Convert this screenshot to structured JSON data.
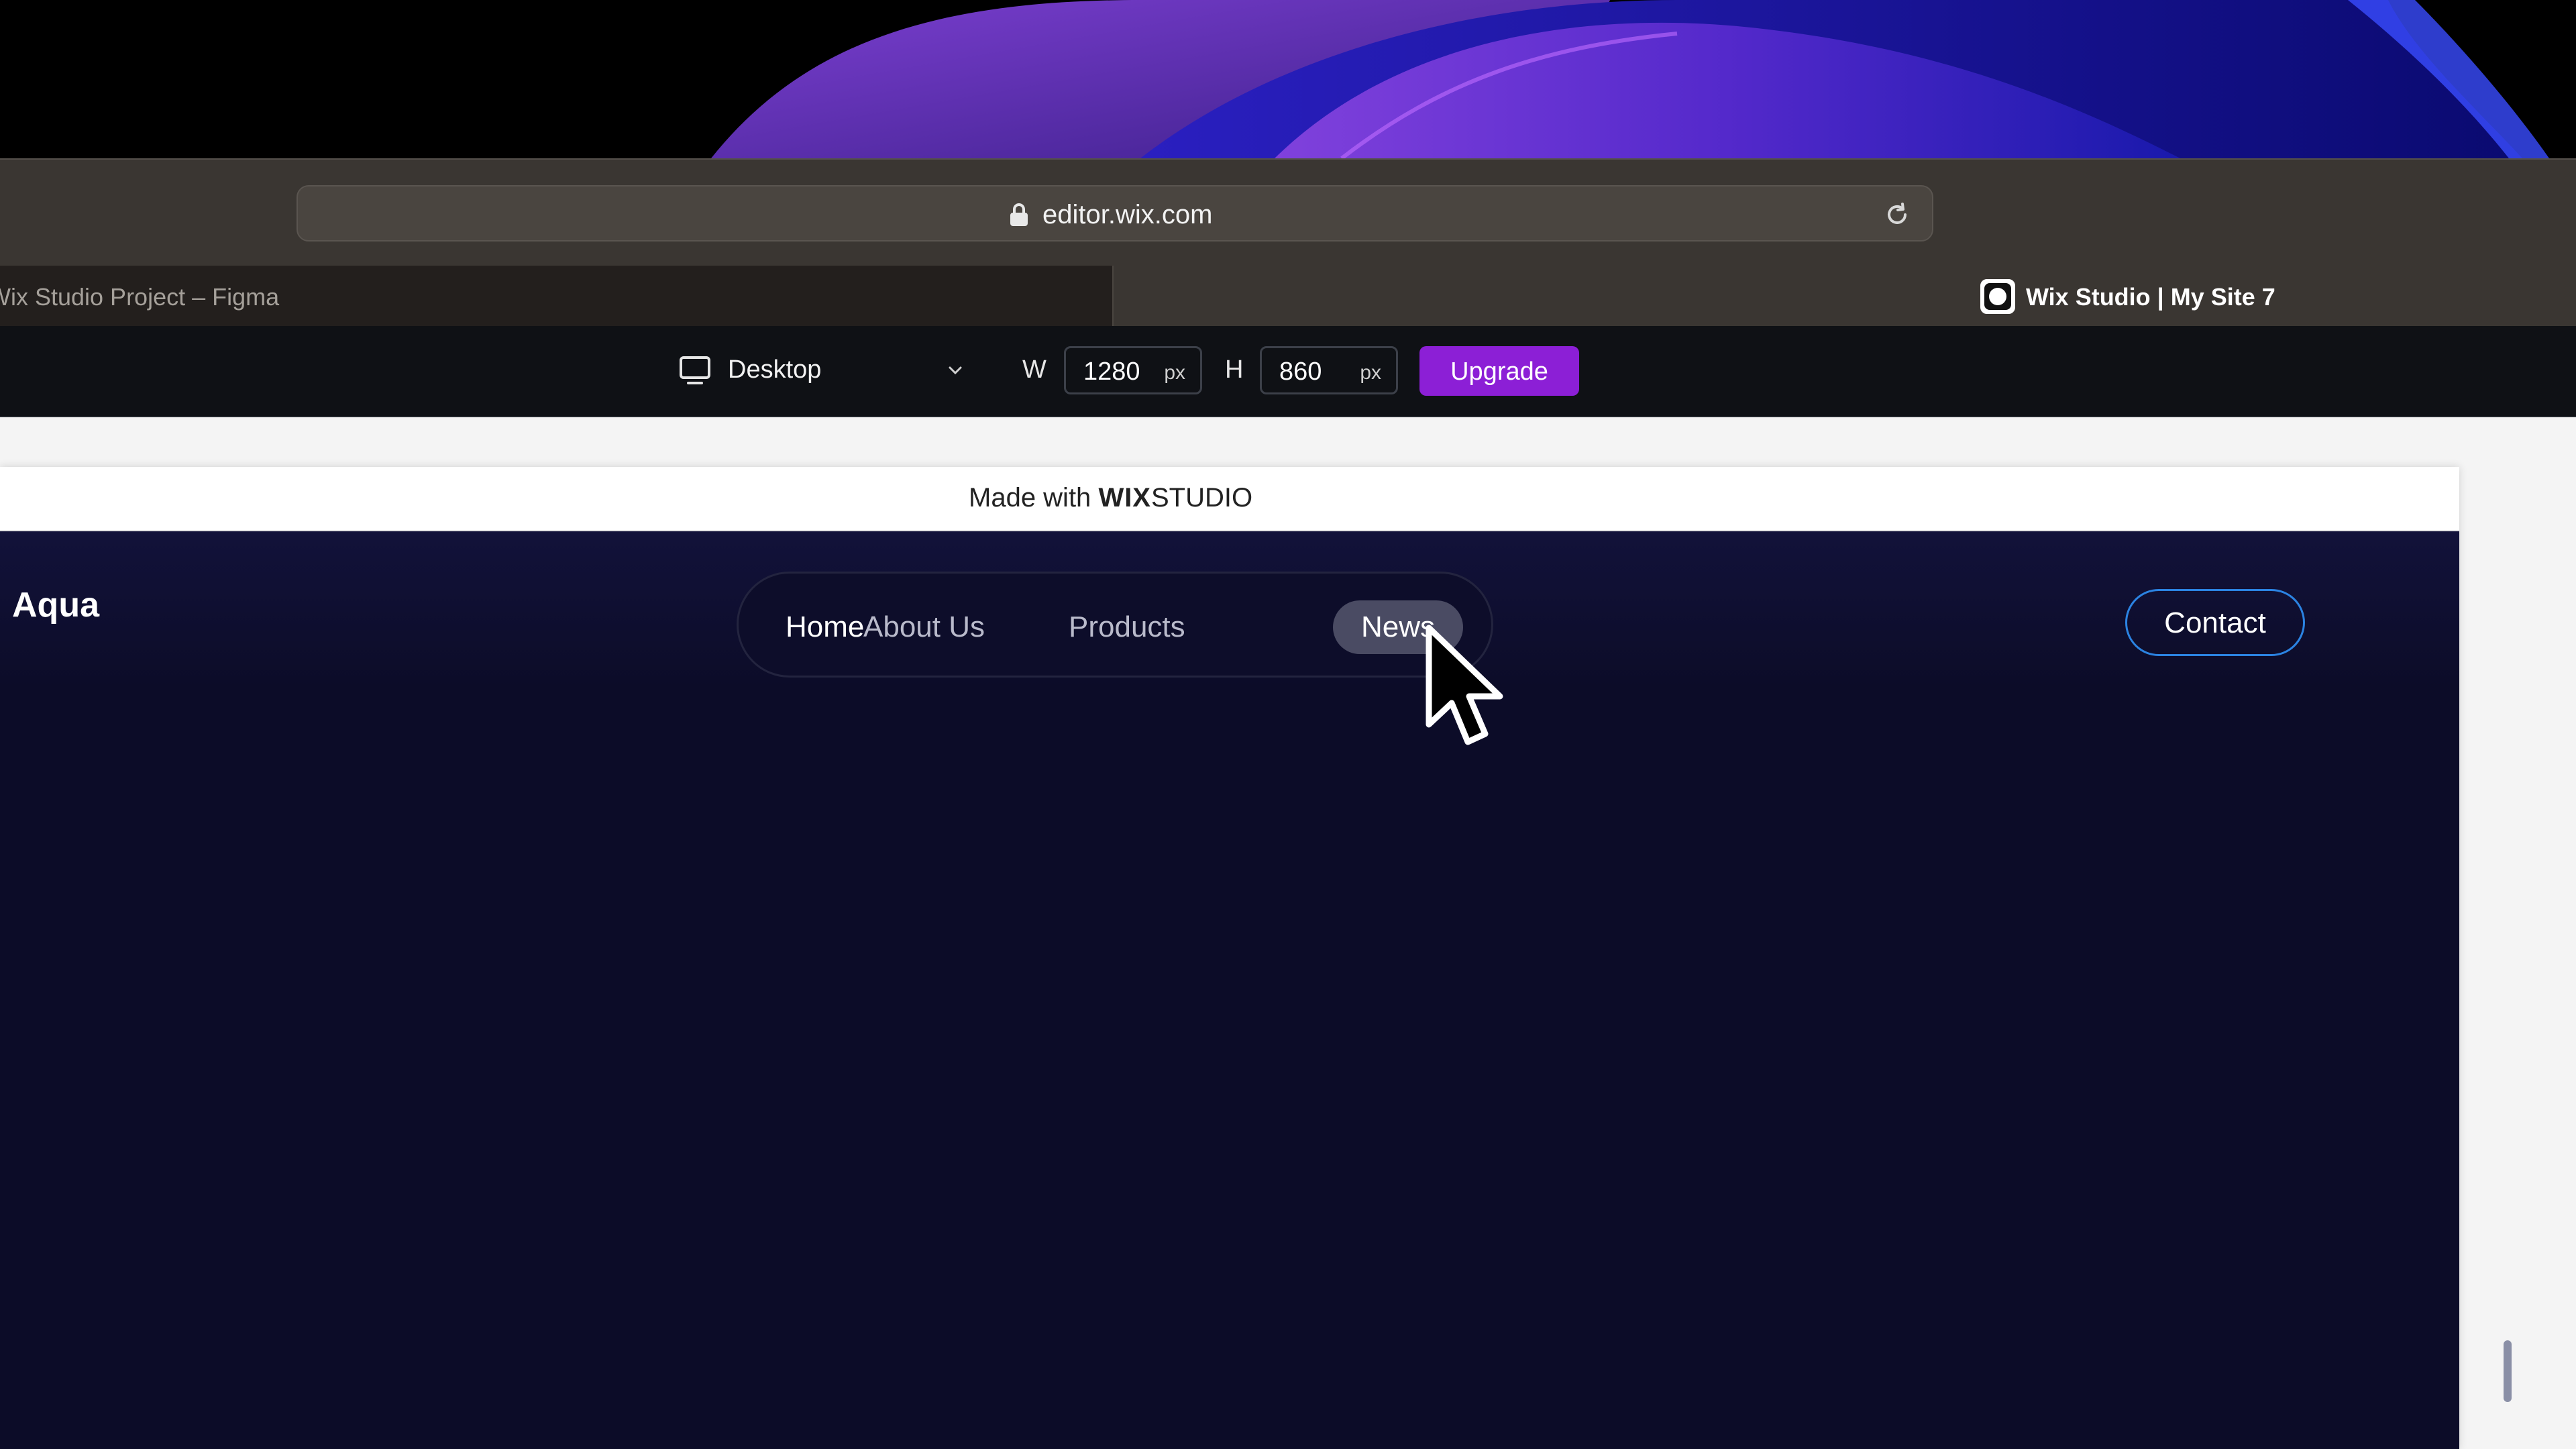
{
  "browser": {
    "url": "editor.wix.com",
    "tabs": [
      {
        "title": "Wix Studio Project – Figma",
        "active": false
      },
      {
        "title": "Wix Studio | My Site 7",
        "active": true
      }
    ]
  },
  "editor_toolbar": {
    "device": "Desktop",
    "width_label": "W",
    "width_value": "1280",
    "height_label": "H",
    "height_value": "860",
    "unit": "px",
    "upgrade_label": "Upgrade",
    "accent_color": "#8c1fd6"
  },
  "site": {
    "made_with": {
      "prefix": "Made with",
      "brand_bold": "WIX",
      "brand_light": "STUDIO"
    },
    "logo": "Aqua",
    "nav": {
      "items": [
        {
          "label": "Home"
        },
        {
          "label": "About Us"
        },
        {
          "label": "Products"
        },
        {
          "label": "News",
          "hovered": true
        }
      ]
    },
    "contact_label": "Contact",
    "background_color": "#0c0c28",
    "contact_border_color": "#2b83e2"
  },
  "icons": {
    "lock": "lock-icon",
    "reload": "reload-icon",
    "device": "desktop-monitor-icon",
    "chevron": "chevron-down-icon",
    "cursor": "mouse-pointer-icon"
  }
}
